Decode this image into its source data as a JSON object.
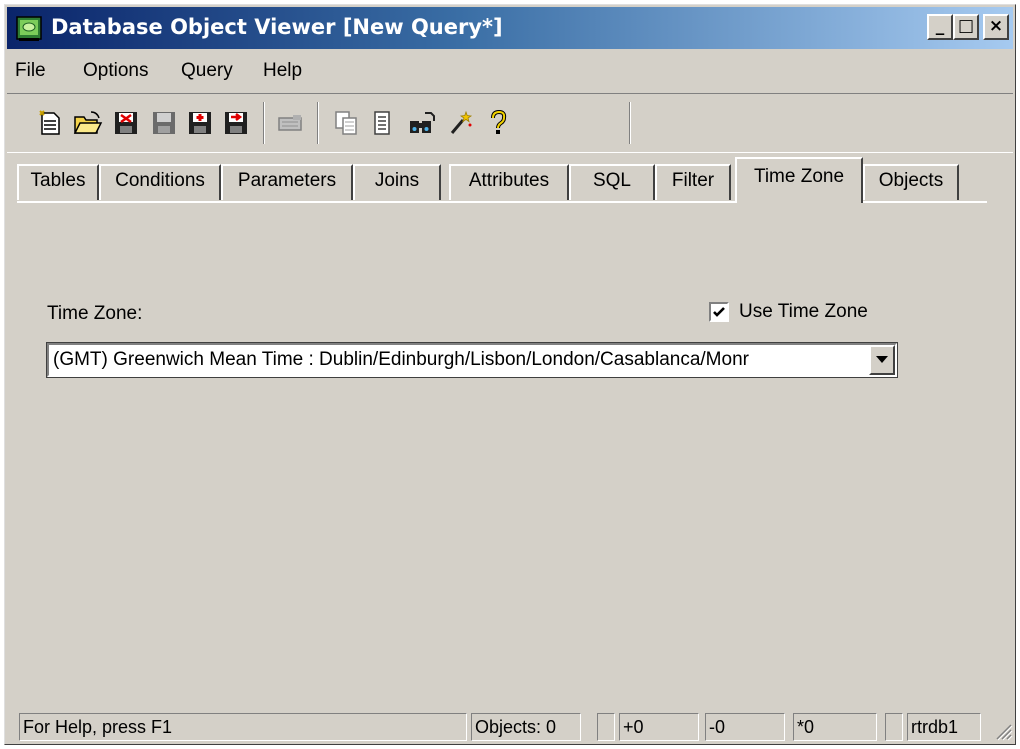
{
  "window": {
    "title": "Database Object Viewer [New Query*]",
    "minimize_label": "_",
    "maximize_label": "□",
    "close_label": "×"
  },
  "menu": [
    "File",
    "Options",
    "Query",
    "Help"
  ],
  "toolbar": {
    "buttons": [
      "new-icon",
      "open-folder-icon",
      "delete-icon",
      "save-icon",
      "save-add-icon",
      "save-as-icon",
      "execute-icon",
      "copy-icon",
      "list-icon",
      "find-icon",
      "wizard-wand-icon",
      "help-question-icon"
    ]
  },
  "tabs": [
    "Tables",
    "Conditions",
    "Parameters",
    "Joins",
    "Attributes",
    "SQL",
    "Filter",
    "Time Zone",
    "Objects"
  ],
  "active_tab": "Time Zone",
  "panel": {
    "time_zone_label": "Time Zone:",
    "use_time_zone_label": "Use Time Zone",
    "use_time_zone_checked": true,
    "time_zone_value": "(GMT) Greenwich Mean Time : Dublin/Edinburgh/Lisbon/London/Casablanca/Monr"
  },
  "statusbar": {
    "help_text": "For Help, press F1",
    "objects": "Objects: 0",
    "plus": "+0",
    "minus": "-0",
    "star": "*0",
    "database": "rtrdb1"
  },
  "colors": {
    "face": "#d4d0c8",
    "title_start": "#0a246a",
    "title_end": "#a6caf0"
  }
}
